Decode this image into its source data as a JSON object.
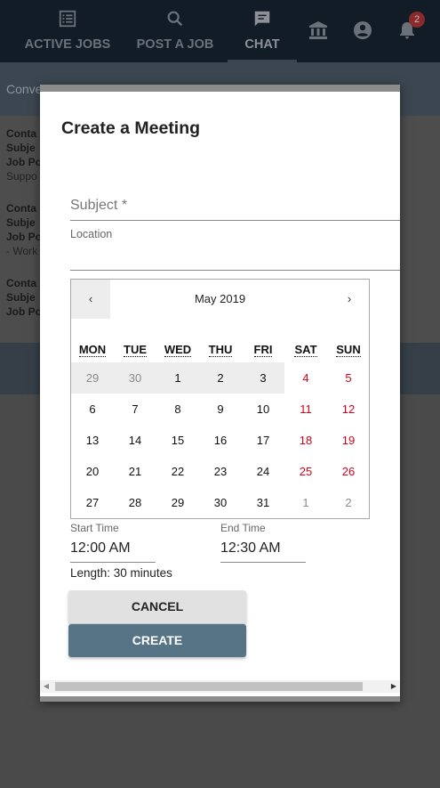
{
  "nav": {
    "items": [
      {
        "label": "ACTIVE JOBS",
        "icon": "list-icon"
      },
      {
        "label": "POST A JOB",
        "icon": "search-icon"
      },
      {
        "label": "CHAT",
        "icon": "chat-icon"
      }
    ],
    "icons": [
      "bank-icon",
      "account-icon",
      "bell-icon"
    ],
    "notification_count": "2"
  },
  "background": {
    "subbar_text": "Conve",
    "lines": [
      "Conta",
      "Subje",
      "Job Po",
      "Suppo",
      "Conta",
      "Subje",
      "Job Po",
      "- Work",
      "Conta",
      "Subje",
      "Job Po"
    ]
  },
  "modal": {
    "title": "Create a Meeting",
    "subject_placeholder": "Subject *",
    "location_label": "Location",
    "calendar": {
      "prev": "‹",
      "next": "›",
      "month": "May 2019",
      "weekdays": [
        "MON",
        "TUE",
        "WED",
        "THU",
        "FRI",
        "SAT",
        "SUN"
      ],
      "weeks": [
        [
          "29",
          "30",
          "1",
          "2",
          "3",
          "4",
          "5"
        ],
        [
          "6",
          "7",
          "8",
          "9",
          "10",
          "11",
          "12"
        ],
        [
          "13",
          "14",
          "15",
          "16",
          "17",
          "18",
          "19"
        ],
        [
          "20",
          "21",
          "22",
          "23",
          "24",
          "25",
          "26"
        ],
        [
          "27",
          "28",
          "29",
          "30",
          "31",
          "1",
          "2"
        ]
      ]
    },
    "start_time_label": "Start Time",
    "start_time": "12:00 AM",
    "end_time_label": "End Time",
    "end_time": "12:30 AM",
    "length": "Length: 30 minutes",
    "cancel_label": "CANCEL",
    "create_label": "CREATE"
  },
  "colors": {
    "nav_bg": "#121c27",
    "create_button": "#577487",
    "weekend": "#d0021b",
    "badge": "#8a2a2a"
  }
}
